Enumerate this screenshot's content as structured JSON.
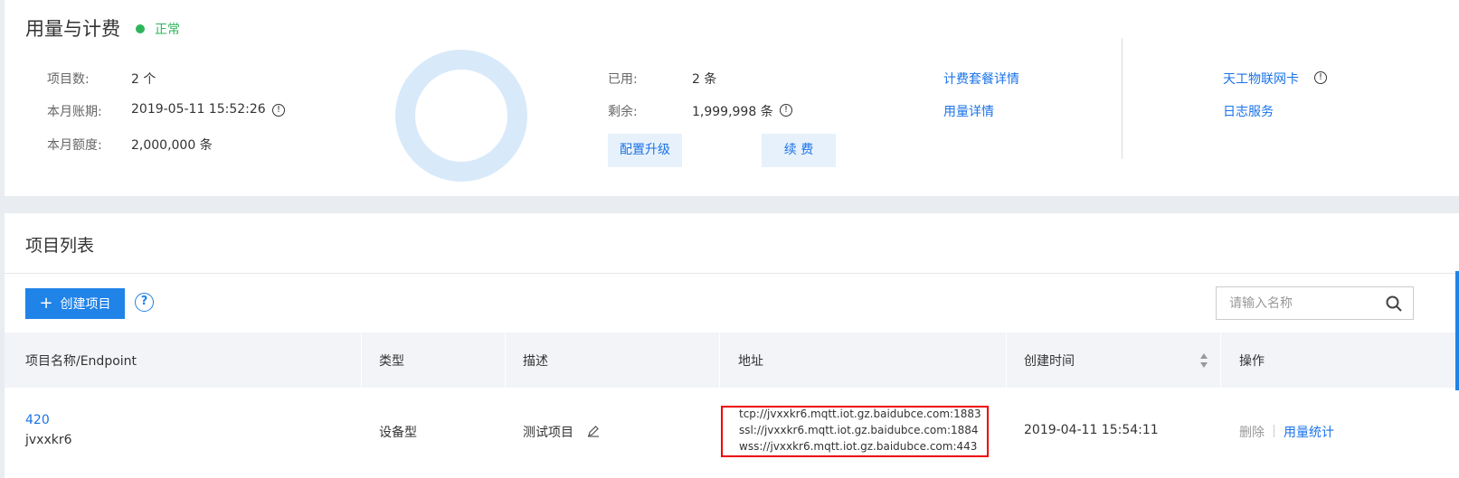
{
  "usage": {
    "title": "用量与计费",
    "status": "正常",
    "colors": {
      "status": "#2fb45a",
      "accent": "#1a73e8",
      "ring": "#d8e9fa"
    },
    "stats": [
      {
        "label": "项目数:",
        "value": "2 个"
      },
      {
        "label": "本月账期:",
        "value": "2019-05-11 15:52:26",
        "info": true
      },
      {
        "label": "本月额度:",
        "value": "2,000,000 条"
      }
    ],
    "used_label": "已用:",
    "used_value": "2 条",
    "remain_label": "剩余:",
    "remain_value": "1,999,998 条",
    "upgrade_button": "配置升级",
    "renew_button": "续 费",
    "links": [
      "计费套餐详情",
      "用量详情"
    ],
    "right_links": [
      "天工物联网卡",
      "日志服务"
    ]
  },
  "projects": {
    "title": "项目列表",
    "create_button": "创建项目",
    "help_icon": "?",
    "search_placeholder": "请输入名称",
    "columns": [
      "项目名称/Endpoint",
      "类型",
      "描述",
      "地址",
      "创建时间",
      "操作"
    ],
    "rows": [
      {
        "name": "420",
        "endpoint": "jvxxkr6",
        "type": "设备型",
        "description": "测试项目",
        "addresses": [
          "tcp://jvxxkr6.mqtt.iot.gz.baidubce.com:1883",
          "ssl://jvxxkr6.mqtt.iot.gz.baidubce.com:1884",
          "wss://jvxxkr6.mqtt.iot.gz.baidubce.com:443"
        ],
        "created": "2019-04-11 15:54:11",
        "actions": [
          "删除",
          "用量统计"
        ]
      }
    ]
  }
}
